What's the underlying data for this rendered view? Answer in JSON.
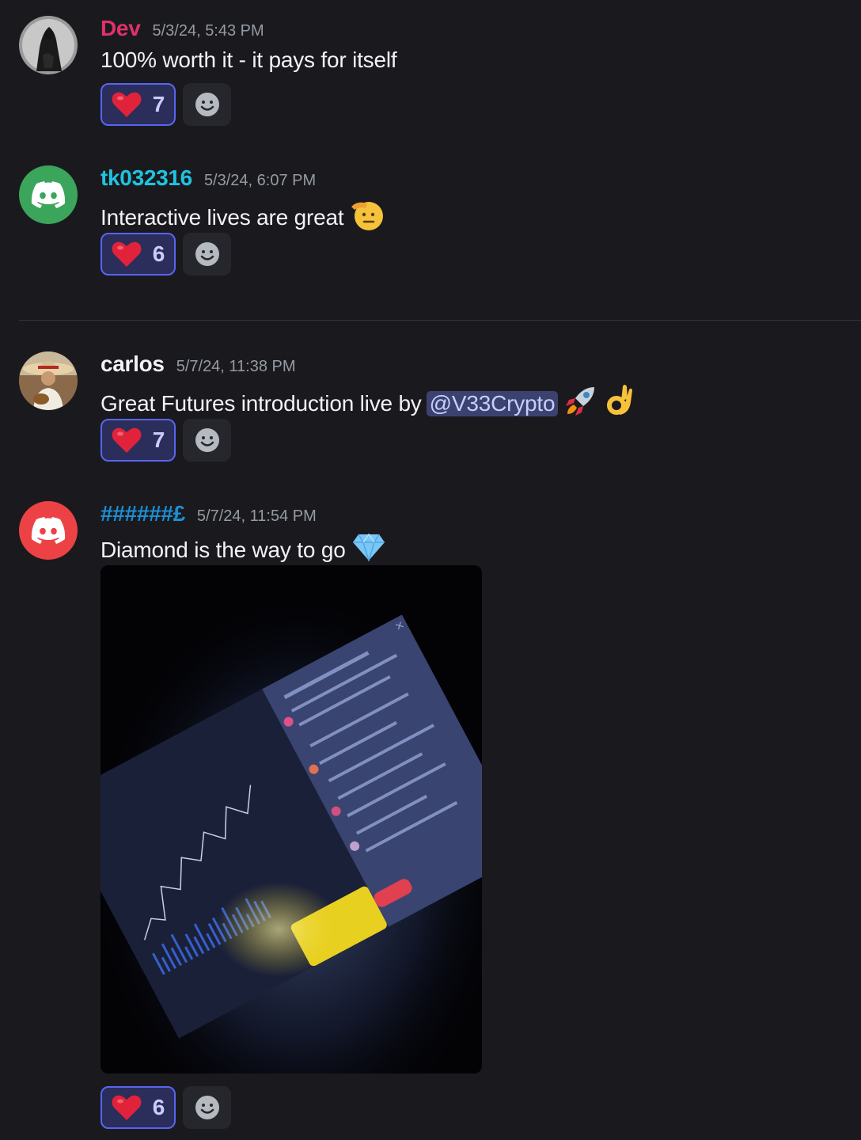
{
  "messages": [
    {
      "username": "Dev",
      "username_color": "#e0316a",
      "timestamp": "5/3/24, 5:43 PM",
      "text": "100% worth it - it pays for itself",
      "reaction": {
        "emoji": "heart",
        "count": "7"
      }
    },
    {
      "username": "tk032316",
      "username_color": "#1fc4e0",
      "timestamp": "5/3/24, 6:07 PM",
      "text": "Interactive lives are great",
      "emoji": "saluting-face",
      "reaction": {
        "emoji": "heart",
        "count": "6"
      }
    },
    {
      "username": "carlos",
      "username_color": "#f2f3f5",
      "timestamp": "5/7/24, 11:38 PM",
      "text": "Great Futures introduction live by",
      "mention": "@V33Crypto",
      "emojis": [
        "rocket",
        "ok-hand"
      ],
      "reaction": {
        "emoji": "heart",
        "count": "7"
      }
    },
    {
      "username": "######£",
      "username_color": "#1c8fd6",
      "timestamp": "5/7/24, 11:54 PM",
      "text": "Diamond is the way to go",
      "emoji": "gem",
      "attachment": "image",
      "reaction": {
        "emoji": "heart",
        "count": "6"
      }
    }
  ],
  "colors": {
    "background": "#1a1a1e",
    "reaction_bg": "#2b2d5a",
    "reaction_border": "#5865f2",
    "discord_green": "#3ba55c",
    "discord_red": "#ed4245"
  }
}
